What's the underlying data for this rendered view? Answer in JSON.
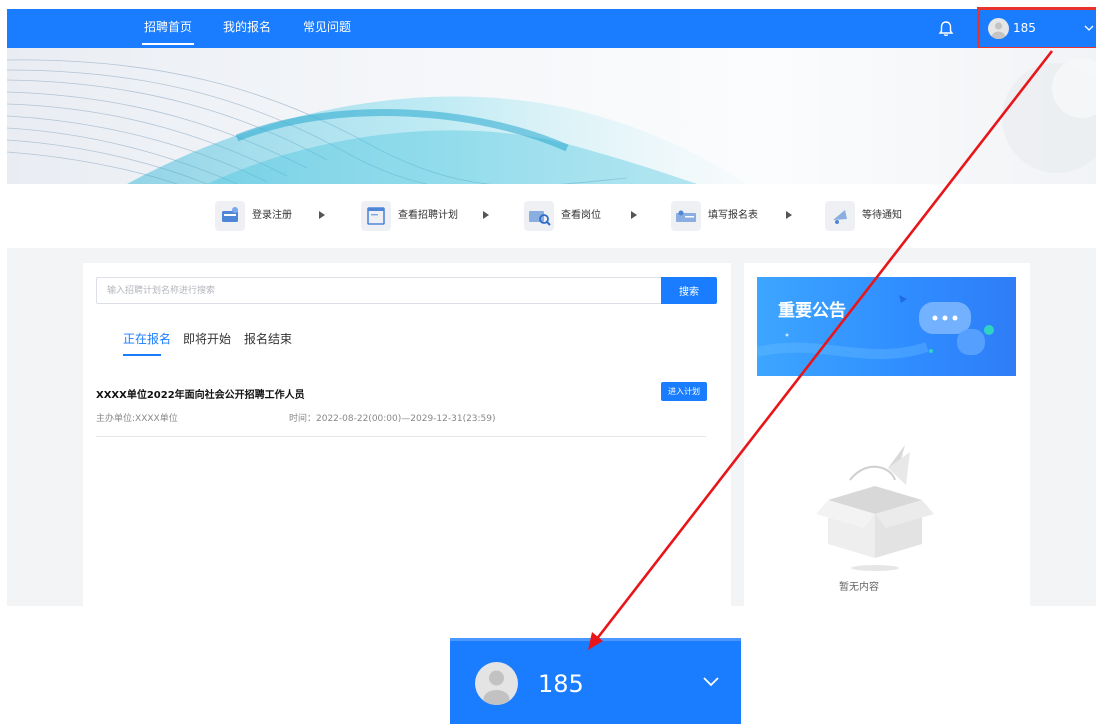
{
  "nav": {
    "items": [
      {
        "label": "招聘首页",
        "active": true
      },
      {
        "label": "我的报名",
        "active": false
      },
      {
        "label": "常见问题",
        "active": false
      }
    ],
    "bell_icon": "bell-icon",
    "user": {
      "name": "185",
      "avatar_icon": "user-avatar-icon",
      "chevron_icon": "chevron-down-icon"
    }
  },
  "steps": [
    {
      "label": "登录注册",
      "icon": "register-icon"
    },
    {
      "label": "查看招聘计划",
      "icon": "plan-icon"
    },
    {
      "label": "查看岗位",
      "icon": "position-search-icon"
    },
    {
      "label": "填写报名表",
      "icon": "form-icon"
    },
    {
      "label": "等待通知",
      "icon": "notice-icon"
    }
  ],
  "search": {
    "placeholder": "输入招聘计划名称进行搜索",
    "value": "",
    "button_label": "搜索"
  },
  "tabs": [
    {
      "label": "正在报名",
      "active": true
    },
    {
      "label": "即将开始",
      "active": false
    },
    {
      "label": "报名结束",
      "active": false
    }
  ],
  "plans": [
    {
      "title": "XXXX单位2022年面向社会公开招聘工作人员",
      "organizer": "主办单位:XXXX单位",
      "time": "时间：2022-08-22(00:00)—2029-12-31(23:59)",
      "button_label": "进入计划"
    }
  ],
  "announcement": {
    "title": "重要公告",
    "empty_text": "暂无内容"
  },
  "zoom_callout": {
    "name": "185"
  },
  "colors": {
    "primary": "#1a7cff",
    "highlight": "#e9332d",
    "arrow": "#e8161a",
    "background_gray": "#f3f4f6"
  }
}
